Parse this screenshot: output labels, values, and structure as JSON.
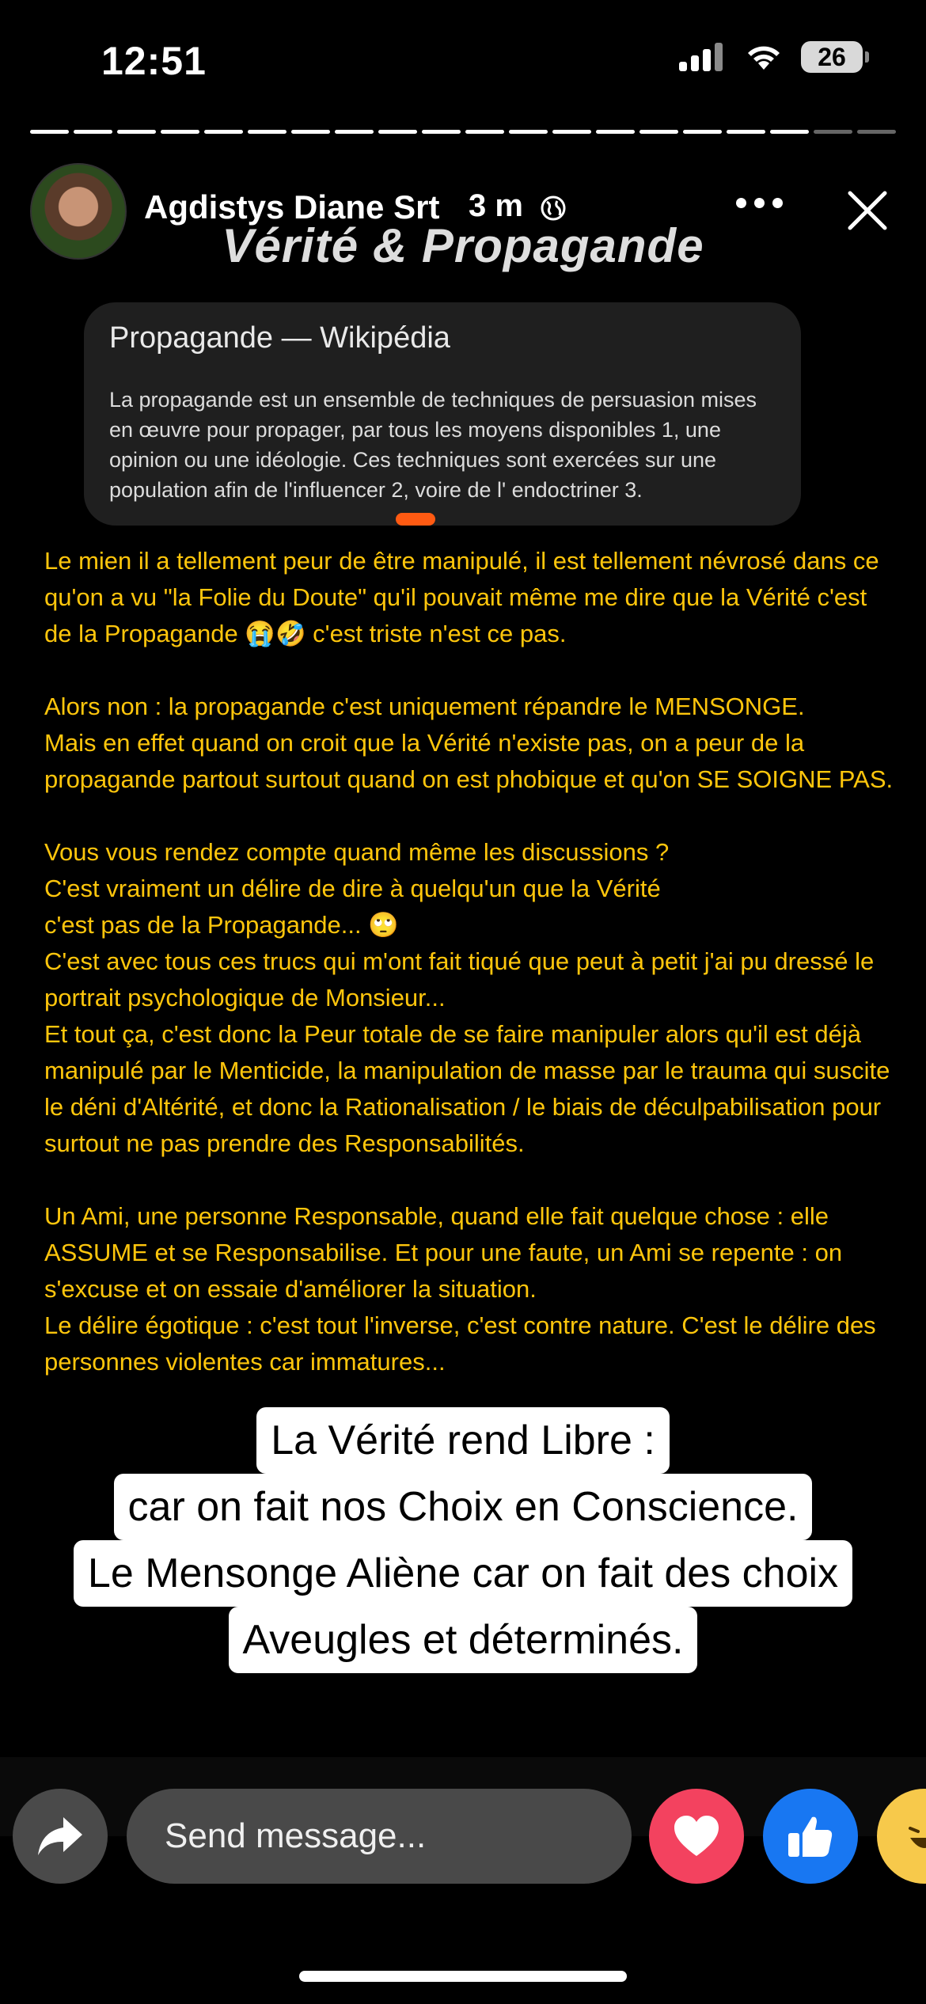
{
  "status_bar": {
    "time": "12:51",
    "battery": "26"
  },
  "story": {
    "segments_total": 20,
    "segments_viewed": 18,
    "author": "Agdistys Diane Srt",
    "time_ago": "3 m",
    "title": "Vérité & Propagande"
  },
  "wiki": {
    "title": "Propagande — Wikipédia",
    "body": "La propagande est un ensemble de techniques de persuasion mises en œuvre pour propager, par tous les moyens disponibles 1, une opinion ou une idéologie. Ces techniques sont exercées sur une population afin de l'influencer 2, voire de l' endoctriner 3."
  },
  "text": {
    "p1": "Le mien il a tellement peur de être manipulé, il est tellement névrosé dans ce qu'on a vu \"la Folie du Doute\" qu'il pouvait même me dire que la Vérité c'est de la Propagande 😭🤣 c'est triste n'est ce pas.",
    "p2a": "Alors non : la propagande c'est uniquement répandre le MENSONGE.",
    "p2b": "Mais en effet quand on croit que la Vérité n'existe pas, on a peur de la propagande partout surtout quand on est phobique et qu'on SE SOIGNE PAS.",
    "p3a": "Vous vous rendez compte quand même les discussions ?",
    "p3b": "C'est vraiment un délire de dire à quelqu'un que la Vérité",
    "p3c": "c'est pas de la Propagande... 🙄",
    "p3d": "C'est avec tous ces trucs qui m'ont fait tiqué que peut à petit j'ai pu dressé le portrait psychologique de Monsieur...",
    "p3e": "Et tout ça, c'est donc la Peur totale de se faire manipuler alors qu'il est déjà manipulé par le Menticide, la manipulation de masse par le trauma qui suscite le déni d'Altérité, et donc la Rationalisation / le biais de déculpabilisation pour surtout ne pas prendre des Responsabilités.",
    "p4a": "Un Ami, une personne Responsable, quand elle fait quelque chose : elle ASSUME et se Responsabilise. Et pour une faute, un Ami se repente : on s'excuse et on essaie d'améliorer la situation.",
    "p4b": "Le délire égotique : c'est tout l'inverse, c'est contre nature. C'est le délire des personnes violentes car immatures..."
  },
  "quote": {
    "line1": "La Vérité rend Libre :",
    "line2": "car on fait nos Choix en Conscience.",
    "line3": "Le Mensonge Aliène car on fait des choix",
    "line4": "Aveugles et déterminés."
  },
  "bottom": {
    "message_placeholder": "Send message..."
  }
}
